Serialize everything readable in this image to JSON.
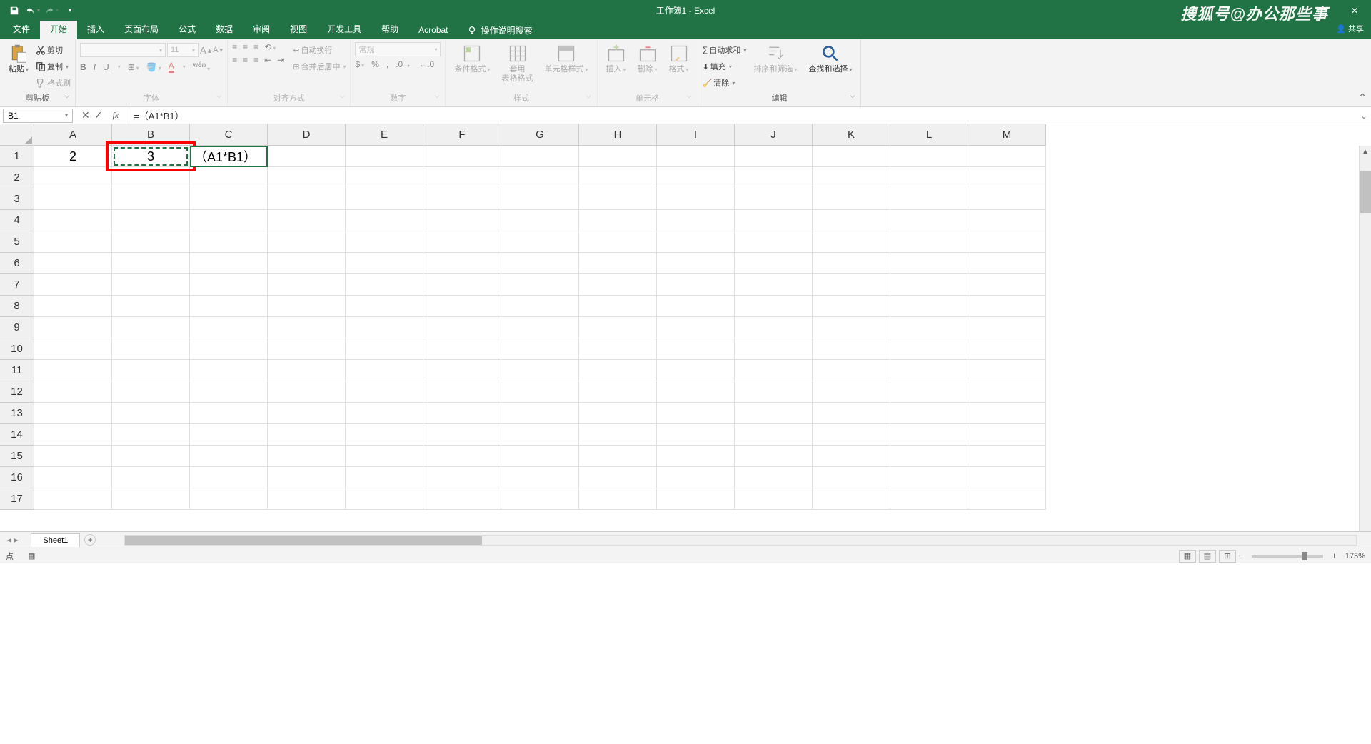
{
  "title": "工作簿1 - Excel",
  "watermark": "搜狐号@办公那些事",
  "share": "共享",
  "tabs": [
    "文件",
    "开始",
    "插入",
    "页面布局",
    "公式",
    "数据",
    "审阅",
    "视图",
    "开发工具",
    "帮助",
    "Acrobat"
  ],
  "active_tab": 1,
  "tell_me": "操作说明搜索",
  "ribbon": {
    "clipboard": {
      "paste": "粘贴",
      "cut": "剪切",
      "copy": "复制",
      "painter": "格式刷",
      "label": "剪贴板"
    },
    "font": {
      "name": "",
      "size": "11",
      "label": "字体"
    },
    "align": {
      "wrap": "自动换行",
      "merge": "合并后居中",
      "label": "对齐方式"
    },
    "number": {
      "format": "常规",
      "label": "数字"
    },
    "styles": {
      "cond": "条件格式",
      "table": "套用\n表格格式",
      "cell": "单元格样式",
      "label": "样式"
    },
    "cells": {
      "insert": "插入",
      "delete": "删除",
      "format": "格式",
      "label": "单元格"
    },
    "editing": {
      "sum": "自动求和",
      "fill": "填充",
      "clear": "清除",
      "sort": "排序和筛选",
      "find": "查找和选择",
      "label": "编辑"
    }
  },
  "name_box": "B1",
  "formula": "=（A1*B1）",
  "columns": [
    "A",
    "B",
    "C",
    "D",
    "E",
    "F",
    "G",
    "H",
    "I",
    "J",
    "K",
    "L",
    "M"
  ],
  "rows": [
    "1",
    "2",
    "3",
    "4",
    "5",
    "6",
    "7",
    "8",
    "9",
    "10",
    "11",
    "12",
    "13",
    "14",
    "15",
    "16",
    "17"
  ],
  "cell_A1": "2",
  "cell_B1": "3",
  "cell_C1": "（A1*B1）",
  "sheet": "Sheet1",
  "status_mode": "点",
  "zoom": "175%"
}
